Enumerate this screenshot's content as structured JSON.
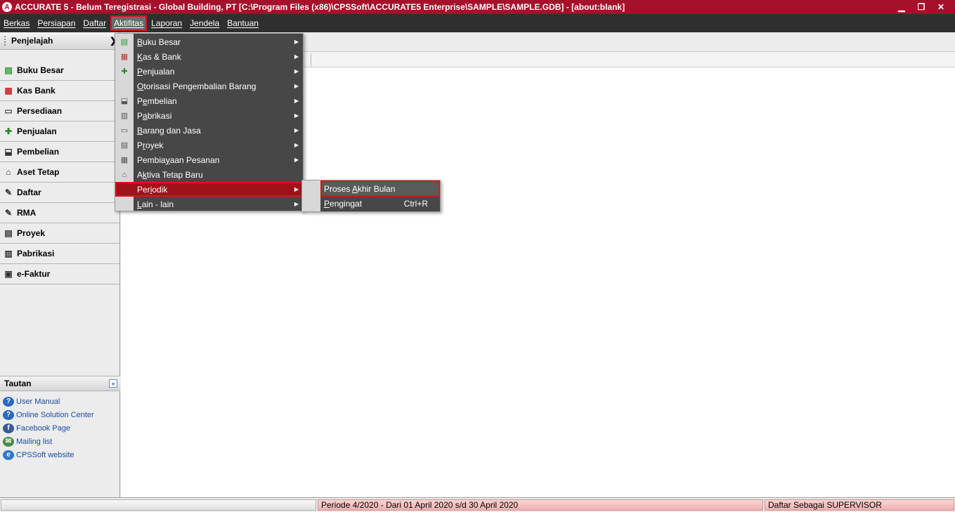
{
  "window": {
    "title": "ACCURATE 5  - Belum Teregistrasi - Global Building, PT   [C:\\Program Files (x86)\\CPSSoft\\ACCURATE5 Enterprise\\SAMPLE\\SAMPLE.GDB] - [about:blank]",
    "logo_glyph": "A",
    "minimize": "▁",
    "restore": "❐",
    "close": "✕"
  },
  "menubar": {
    "items": [
      {
        "label": "Berkas"
      },
      {
        "label": "Persiapan"
      },
      {
        "label": "Daftar"
      },
      {
        "label": "Aktifitas",
        "active": true
      },
      {
        "label": "Laporan"
      },
      {
        "label": "Jendela"
      },
      {
        "label": "Bantuan"
      }
    ]
  },
  "sidebar": {
    "header": "Penjelajah",
    "collapse_glyph": "❯",
    "items": [
      {
        "label": "Buku Besar",
        "icon": "ledger-icon",
        "glyph": "▤",
        "color": "#2a9a2a"
      },
      {
        "label": "Kas Bank",
        "icon": "cash-bank-icon",
        "glyph": "▦",
        "color": "#c03030"
      },
      {
        "label": "Persediaan",
        "icon": "inventory-icon",
        "glyph": "▭",
        "color": "#4a4a4a"
      },
      {
        "label": "Penjualan",
        "icon": "sales-icon",
        "glyph": "✚",
        "color": "#2a8a2a"
      },
      {
        "label": "Pembelian",
        "icon": "cart-icon",
        "glyph": "⬓",
        "color": "#333333"
      },
      {
        "label": "Aset Tetap",
        "icon": "house-icon",
        "glyph": "⌂",
        "color": "#333333"
      },
      {
        "label": "Daftar",
        "icon": "list-icon",
        "glyph": "✎",
        "color": "#333333"
      },
      {
        "label": "RMA",
        "icon": "rma-icon",
        "glyph": "✎",
        "color": "#333333"
      },
      {
        "label": "Proyek",
        "icon": "project-icon",
        "glyph": "▤",
        "color": "#333333"
      },
      {
        "label": "Pabrikasi",
        "icon": "factory-icon",
        "glyph": "▥",
        "color": "#333333"
      },
      {
        "label": "e-Faktur",
        "icon": "efaktur-icon",
        "glyph": "▣",
        "color": "#333333"
      }
    ]
  },
  "tautan": {
    "header": "Tautan",
    "toggle_glyph": "»",
    "links": [
      {
        "label": "User Manual",
        "icon": "help-icon",
        "glyph": "?",
        "color": "#2a6ac0"
      },
      {
        "label": "Online Solution Center",
        "icon": "help-icon",
        "glyph": "?",
        "color": "#2a6ac0"
      },
      {
        "label": "Facebook Page",
        "icon": "facebook-icon",
        "glyph": "f",
        "color": "#3b5998"
      },
      {
        "label": "Mailing list",
        "icon": "mail-icon",
        "glyph": "✉",
        "color": "#4a8a4a"
      },
      {
        "label": "CPSSoft website",
        "icon": "ie-icon",
        "glyph": "e",
        "color": "#2a7ad0"
      }
    ]
  },
  "dropdown": {
    "items": [
      {
        "label": "Buku Besar",
        "u": "B",
        "rest": "uku Besar",
        "icon": "ledger-icon",
        "glyph": "▤",
        "color": "#2a9a2a",
        "submenu": true
      },
      {
        "label": "Kas & Bank",
        "u": "K",
        "rest": "as & Bank",
        "icon": "cash-bank-icon",
        "glyph": "▦",
        "color": "#c03030",
        "submenu": true
      },
      {
        "label": "Penjualan",
        "u": "P",
        "rest": "enjualan",
        "icon": "sales-icon",
        "glyph": "✚",
        "color": "#2a8a2a",
        "submenu": true
      },
      {
        "label": "Otorisasi Pengembalian Barang",
        "u": "O",
        "rest": "torisasi Pengembalian Barang",
        "icon": "",
        "glyph": "",
        "color": "#333333",
        "submenu": true
      },
      {
        "label": "Pembelian",
        "u": "e",
        "pre": "P",
        "rest": "mbelian",
        "icon": "cart-icon",
        "glyph": "⬓",
        "color": "#555555",
        "submenu": true
      },
      {
        "label": "Pabrikasi",
        "u": "a",
        "pre": "P",
        "rest": "brikasi",
        "icon": "factory-icon",
        "glyph": "▥",
        "color": "#555555",
        "submenu": true
      },
      {
        "label": "Barang dan Jasa",
        "u": "B",
        "rest": "arang dan Jasa",
        "icon": "inventory-icon",
        "glyph": "▭",
        "color": "#555555",
        "submenu": true
      },
      {
        "label": "Proyek",
        "u": "r",
        "pre": "P",
        "rest": "oyek",
        "icon": "project-icon",
        "glyph": "▤",
        "color": "#555555",
        "submenu": true
      },
      {
        "label": "Pembiayaan Pesanan",
        "u": "y",
        "pre": "Pembia",
        "rest": "aan Pesanan",
        "icon": "order-icon",
        "glyph": "▦",
        "color": "#555555",
        "submenu": true
      },
      {
        "label": "Aktiva Tetap Baru",
        "u": "k",
        "pre": "A",
        "rest": "tiva Tetap Baru",
        "icon": "house-icon",
        "glyph": "⌂",
        "color": "#555555",
        "submenu": false
      },
      {
        "label": "Periodik",
        "u": "i",
        "pre": "Per",
        "rest": "odik",
        "icon": "",
        "glyph": "",
        "color": "#333333",
        "submenu": true,
        "highlighted": true
      },
      {
        "label": "Lain - lain",
        "u": "L",
        "rest": "ain - lain",
        "icon": "",
        "glyph": "",
        "color": "#333333",
        "submenu": true
      }
    ],
    "arrow_glyph": "▶"
  },
  "submenu": {
    "items": [
      {
        "label": "Proses Akhir Bulan",
        "pre": "Proses ",
        "u": "A",
        "rest": "khir Bulan",
        "shortcut": "",
        "highlighted": true
      },
      {
        "label": "Pengingat",
        "pre": "",
        "u": "P",
        "rest": "engingat",
        "shortcut": "Ctrl+R",
        "highlighted": false
      }
    ]
  },
  "statusbar": {
    "blank": "",
    "periode": "Periode 4/2020 - Dari 01 April 2020 s/d 30 April 2020",
    "user": "Daftar Sebagai SUPERVISOR"
  }
}
